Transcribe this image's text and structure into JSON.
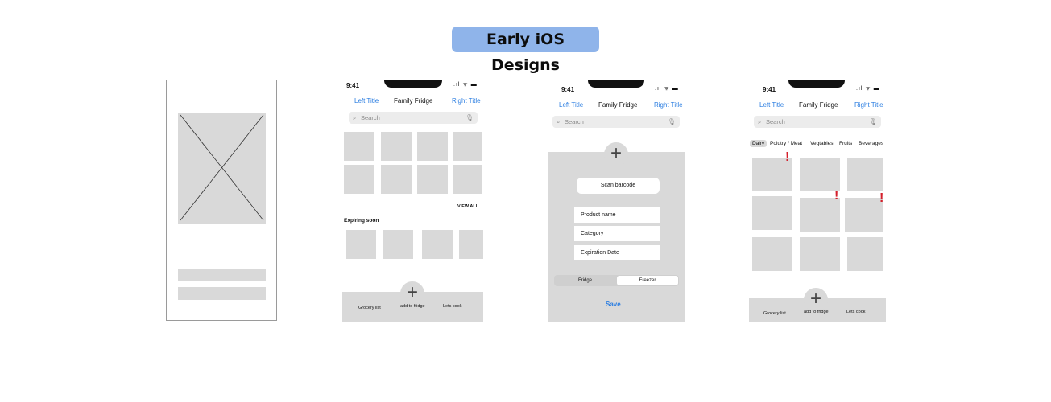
{
  "page": {
    "title": "Early iOS Designs"
  },
  "status_time": "9:41",
  "status_icons": ".ıl ᯤ ▬",
  "nav": {
    "left": "Left Title",
    "center": "Family Fridge",
    "right": "Right Title"
  },
  "search": {
    "placeholder": "Search",
    "search_icon": "⌕",
    "mic_icon": "🎙"
  },
  "screen2": {
    "view_all": "VIEW ALL",
    "expiring_soon": "Expiring soon"
  },
  "tabbar": {
    "plus": "+",
    "grocery": "Grocery list",
    "add": "add to fridge",
    "cook": "Lets cook"
  },
  "screen3": {
    "plus": "+",
    "scan": "Scan barcode",
    "fields": [
      "Product name",
      "Category",
      "Expiration Date"
    ],
    "segments": [
      "Fridge",
      "Freezer"
    ],
    "save": "Save"
  },
  "screen4": {
    "categories": [
      "Dairy",
      "Polutry / Meat",
      "Vegtables",
      "Fruits",
      "Beverages"
    ],
    "alert": "!"
  },
  "colors": {
    "accent": "#2a7de1",
    "title_bg": "#8fb4ea",
    "alert": "#d4202c",
    "placeholder": "#d9d9d9"
  }
}
